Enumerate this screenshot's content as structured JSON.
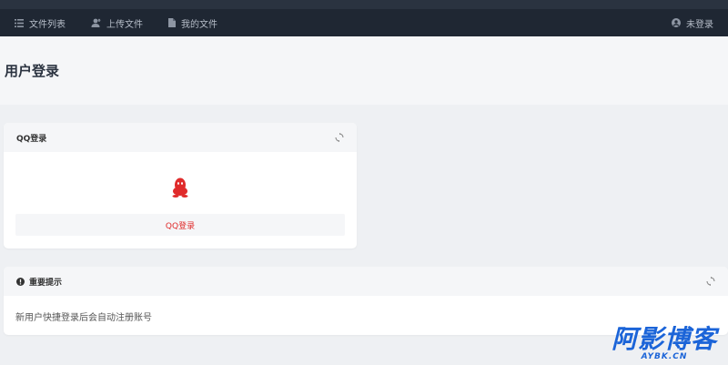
{
  "nav": {
    "items": [
      {
        "label": "文件列表",
        "icon": "list-icon"
      },
      {
        "label": "上传文件",
        "icon": "upload-user-icon"
      },
      {
        "label": "我的文件",
        "icon": "file-icon"
      }
    ],
    "login_label": "未登录"
  },
  "page": {
    "title": "用户登录"
  },
  "qq_panel": {
    "title": "QQ登录",
    "button_label": "QQ登录"
  },
  "notice_panel": {
    "title": "重要提示",
    "text": "新用户快捷登录后会自动注册账号"
  },
  "watermark": {
    "main": "阿影博客",
    "sub": "AYBK.CN"
  },
  "colors": {
    "nav_bg": "#1f2733",
    "accent_red": "#e02b2b",
    "watermark_blue": "#1b64d8"
  }
}
